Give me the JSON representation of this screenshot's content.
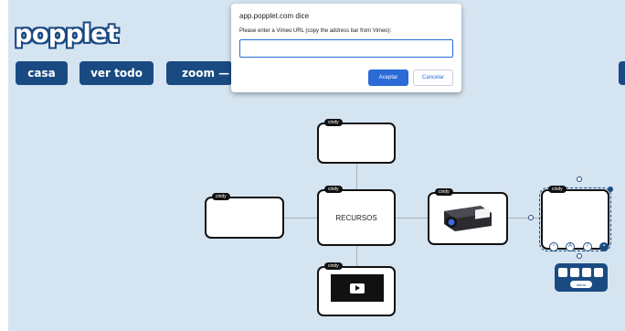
{
  "app": {
    "logo_text": "popplet",
    "brand_color": "#1a4a82",
    "canvas_color": "#d5e4f1"
  },
  "nav": {
    "casa": "casa",
    "ver_todo": "ver todo",
    "zoom": "zoom —"
  },
  "dialog": {
    "title": "app.popplet.com dice",
    "message": "Please enter a Vimeo URL (copy the address bar from Vimeo):",
    "input_value": "",
    "ok_label": "Aceptar",
    "cancel_label": "Cancelar"
  },
  "popples": {
    "author": "cindy",
    "center_text": "RECURSOS",
    "video_icon": "play-icon",
    "image_desc_icon": "projector-image"
  },
  "toolbar_icons": [
    "square-icon",
    "text-icon",
    "pencil-icon",
    "image-icon"
  ],
  "panel": {
    "icons": [
      "download-icon",
      "vimeo-icon",
      "youtube-icon",
      "image-icon"
    ],
    "button_label": "retirar"
  }
}
